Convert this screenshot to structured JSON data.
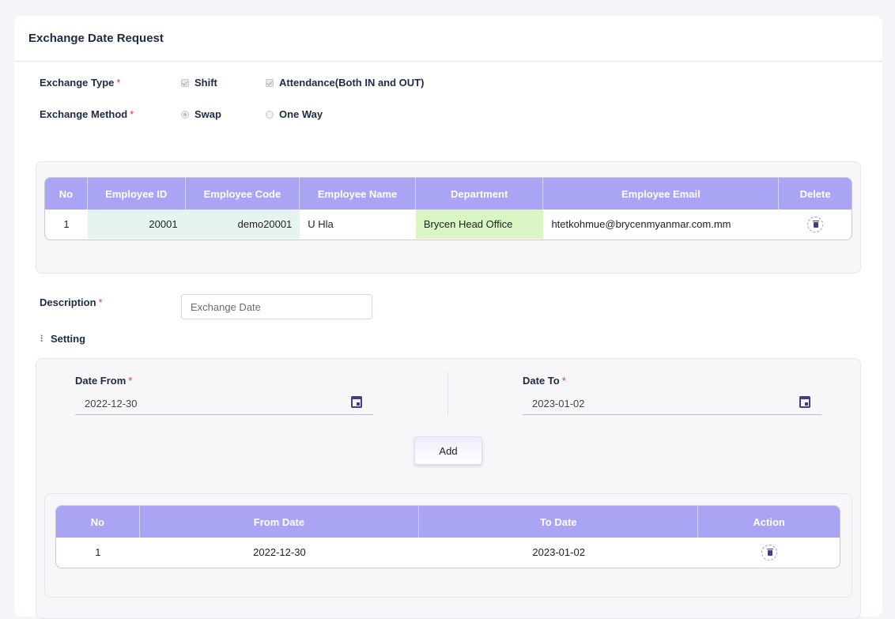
{
  "page": {
    "title": "Exchange Date Request"
  },
  "exchange_type": {
    "label": "Exchange Type",
    "required_mark": "*",
    "options": [
      {
        "label": "Shift",
        "checked": true
      },
      {
        "label": "Attendance(Both IN and OUT)",
        "checked": true
      }
    ]
  },
  "exchange_method": {
    "label": "Exchange Method",
    "required_mark": "*",
    "options": [
      {
        "label": "Swap",
        "selected": true
      },
      {
        "label": "One Way",
        "selected": false
      }
    ]
  },
  "employee_table": {
    "headers": [
      "No",
      "Employee ID",
      "Employee Code",
      "Employee Name",
      "Department",
      "Employee Email",
      "Delete"
    ],
    "rows": [
      {
        "no": "1",
        "employee_id": "20001",
        "employee_code": "demo20001",
        "employee_name": "U Hla",
        "department": "Brycen Head Office",
        "email": "htetkohmue@brycenmyanmar.com.mm"
      }
    ]
  },
  "description": {
    "label": "Description",
    "required_mark": "*",
    "placeholder": "Exchange Date",
    "value": ""
  },
  "setting": {
    "label": "Setting",
    "date_from": {
      "label": "Date From",
      "required_mark": "*",
      "value": "2022-12-30"
    },
    "date_to": {
      "label": "Date To",
      "required_mark": "*",
      "value": "2023-01-02"
    },
    "add_label": "Add"
  },
  "date_table": {
    "headers": [
      "No",
      "From Date",
      "To Date",
      "Action"
    ],
    "rows": [
      {
        "no": "1",
        "from_date": "2022-12-30",
        "to_date": "2023-01-02"
      }
    ]
  },
  "colors": {
    "header_purple": "#a9a4f4",
    "teal_cell": "#e6f4f1",
    "green_cell": "#d8f5c3",
    "icon_navy": "#3b3f8c",
    "required_red": "#e53935"
  }
}
